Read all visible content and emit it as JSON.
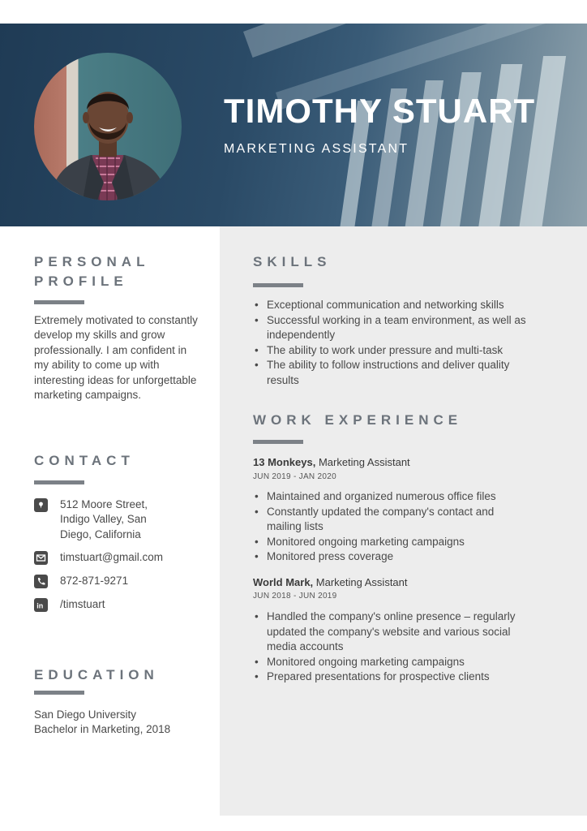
{
  "header": {
    "name": "TIMOTHY STUART",
    "role": "MARKETING ASSISTANT"
  },
  "profile": {
    "title_line1": "PERSONAL",
    "title_line2": "PROFILE",
    "text": "Extremely motivated to constantly develop my skills and grow professionally. I am confident in my ability to come up with interesting ideas for unforgettable marketing campaigns."
  },
  "contact": {
    "title": "CONTACT",
    "address_line1": "512 Moore Street,",
    "address_line2": "Indigo Valley, San",
    "address_line3": "Diego, California",
    "email": "timstuart@gmail.com",
    "phone": "872-871-9271",
    "linkedin": "/timstuart",
    "icons": [
      "location-icon",
      "email-icon",
      "phone-icon",
      "linkedin-icon"
    ]
  },
  "education": {
    "title": "EDUCATION",
    "school": "San Diego University",
    "degree": "Bachelor in Marketing, 2018"
  },
  "skills": {
    "title": "SKILLS",
    "items": [
      [
        "Exceptional communication and networking skills"
      ],
      [
        "Successful working in a team environment, as well as",
        "independently"
      ],
      [
        "The ability to work under pressure and multi-task"
      ],
      [
        "The ability to follow instructions and deliver quality",
        "results"
      ]
    ]
  },
  "experience": {
    "title": "WORK EXPERIENCE",
    "jobs": [
      {
        "company": "13 Monkeys,",
        "position": " Marketing Assistant",
        "dates": "JUN 2019 - JAN 2020",
        "bullets": [
          [
            "Maintained and organized numerous office files"
          ],
          [
            "Constantly updated the company's contact and",
            "mailing lists"
          ],
          [
            "Monitored ongoing marketing campaigns"
          ],
          [
            "Monitored press coverage"
          ]
        ]
      },
      {
        "company": "World Mark,",
        "position": " Marketing Assistant",
        "dates": "JUN 2018 - JUN 2019",
        "bullets": [
          [
            "Handled the company's online presence – regularly",
            "updated the company's website and various social",
            "media accounts"
          ],
          [
            "Monitored ongoing marketing campaigns"
          ],
          [
            "Prepared presentations for prospective clients"
          ]
        ]
      }
    ]
  },
  "colors": {
    "header_dark": "#1f3b55",
    "panel_gray": "#ededed",
    "heading_gray": "#6c737b",
    "text": "#4a4a4a"
  }
}
